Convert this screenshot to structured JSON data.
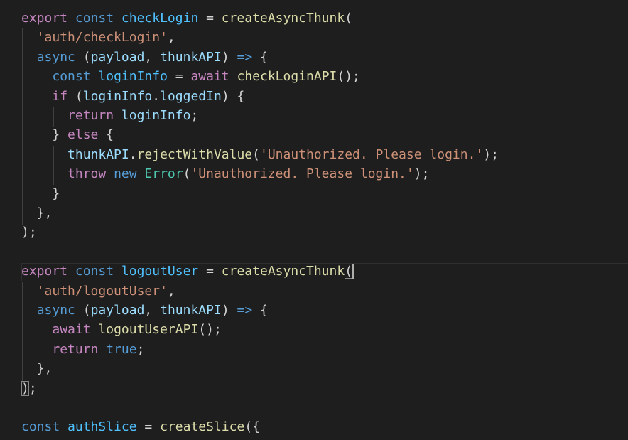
{
  "editor": {
    "theme": {
      "background": "#1e1e1e",
      "keyword": "#c586c0",
      "storage": "#569cd6",
      "constant": "#4fc1ff",
      "function": "#dcdcaa",
      "string": "#ce9178",
      "variable": "#9cdcfe",
      "class": "#4ec9b0",
      "punctuation": "#d4d4d4"
    },
    "lines": [
      [
        [
          "kw",
          "export"
        ],
        [
          "pun",
          " "
        ],
        [
          "st",
          "const"
        ],
        [
          "pun",
          " "
        ],
        [
          "cn",
          "checkLogin"
        ],
        [
          "pun",
          " = "
        ],
        [
          "fn",
          "createAsyncThunk"
        ],
        [
          "pun",
          "("
        ]
      ],
      [
        [
          "pun",
          "  "
        ],
        [
          "str",
          "'auth/checkLogin'"
        ],
        [
          "pun",
          ","
        ]
      ],
      [
        [
          "pun",
          "  "
        ],
        [
          "st",
          "async"
        ],
        [
          "pun",
          " ("
        ],
        [
          "par",
          "payload"
        ],
        [
          "pun",
          ", "
        ],
        [
          "par",
          "thunkAPI"
        ],
        [
          "pun",
          ") "
        ],
        [
          "st",
          "=>"
        ],
        [
          "pun",
          " {"
        ]
      ],
      [
        [
          "pun",
          "    "
        ],
        [
          "st",
          "const"
        ],
        [
          "pun",
          " "
        ],
        [
          "cn",
          "loginInfo"
        ],
        [
          "pun",
          " = "
        ],
        [
          "kw",
          "await"
        ],
        [
          "pun",
          " "
        ],
        [
          "fn",
          "checkLoginAPI"
        ],
        [
          "pun",
          "();"
        ]
      ],
      [
        [
          "pun",
          "    "
        ],
        [
          "kw",
          "if"
        ],
        [
          "pun",
          " ("
        ],
        [
          "var",
          "loginInfo"
        ],
        [
          "pun",
          "."
        ],
        [
          "var",
          "loggedIn"
        ],
        [
          "pun",
          ") {"
        ]
      ],
      [
        [
          "pun",
          "      "
        ],
        [
          "kw",
          "return"
        ],
        [
          "pun",
          " "
        ],
        [
          "var",
          "loginInfo"
        ],
        [
          "pun",
          ";"
        ]
      ],
      [
        [
          "pun",
          "    } "
        ],
        [
          "kw",
          "else"
        ],
        [
          "pun",
          " {"
        ]
      ],
      [
        [
          "pun",
          "      "
        ],
        [
          "var",
          "thunkAPI"
        ],
        [
          "pun",
          "."
        ],
        [
          "fn",
          "rejectWithValue"
        ],
        [
          "pun",
          "("
        ],
        [
          "str",
          "'Unauthorized. Please login.'"
        ],
        [
          "pun",
          ");"
        ]
      ],
      [
        [
          "pun",
          "      "
        ],
        [
          "kw",
          "throw"
        ],
        [
          "pun",
          " "
        ],
        [
          "st",
          "new"
        ],
        [
          "pun",
          " "
        ],
        [
          "cls",
          "Error"
        ],
        [
          "pun",
          "("
        ],
        [
          "str",
          "'Unauthorized. Please login.'"
        ],
        [
          "pun",
          ");"
        ]
      ],
      [
        [
          "pun",
          "    }"
        ]
      ],
      [
        [
          "pun",
          "  },"
        ]
      ],
      [
        [
          "pun",
          ");"
        ]
      ],
      [],
      [
        [
          "kw",
          "export"
        ],
        [
          "pun",
          " "
        ],
        [
          "st",
          "const"
        ],
        [
          "pun",
          " "
        ],
        [
          "cn",
          "logoutUser"
        ],
        [
          "pun",
          " = "
        ],
        [
          "fn",
          "createAsyncThunk"
        ],
        [
          "pun",
          "("
        ]
      ],
      [
        [
          "pun",
          "  "
        ],
        [
          "str",
          "'auth/logoutUser'"
        ],
        [
          "pun",
          ","
        ]
      ],
      [
        [
          "pun",
          "  "
        ],
        [
          "st",
          "async"
        ],
        [
          "pun",
          " ("
        ],
        [
          "par",
          "payload"
        ],
        [
          "pun",
          ", "
        ],
        [
          "par",
          "thunkAPI"
        ],
        [
          "pun",
          ") "
        ],
        [
          "st",
          "=>"
        ],
        [
          "pun",
          " {"
        ]
      ],
      [
        [
          "pun",
          "    "
        ],
        [
          "kw",
          "await"
        ],
        [
          "pun",
          " "
        ],
        [
          "fn",
          "logoutUserAPI"
        ],
        [
          "pun",
          "();"
        ]
      ],
      [
        [
          "pun",
          "    "
        ],
        [
          "kw",
          "return"
        ],
        [
          "pun",
          " "
        ],
        [
          "st",
          "true"
        ],
        [
          "pun",
          ";"
        ]
      ],
      [
        [
          "pun",
          "  },"
        ]
      ],
      [
        [
          "pun",
          ");"
        ]
      ],
      [],
      [
        [
          "st",
          "const"
        ],
        [
          "pun",
          " "
        ],
        [
          "cn",
          "authSlice"
        ],
        [
          "pun",
          " = "
        ],
        [
          "fn",
          "createSlice"
        ],
        [
          "pun",
          "({"
        ]
      ]
    ]
  }
}
